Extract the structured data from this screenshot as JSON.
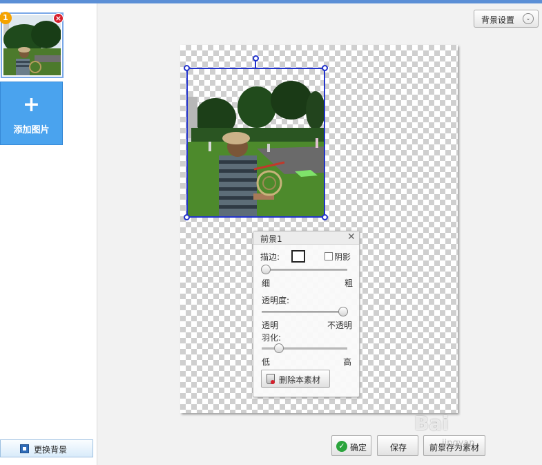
{
  "left_panel": {
    "thumbnail_index": "1",
    "thumbnail_close": "×",
    "add_image_label": "添加图片",
    "add_image_icon": "plus-icon",
    "change_bg_label": "更换背景"
  },
  "toolbar": {
    "bg_settings_label": "背景设置",
    "bg_settings_arrow": "⌄"
  },
  "fg_panel": {
    "title": "前景1",
    "close": "✕",
    "stroke_label": "描边:",
    "shadow_label": "阴影",
    "shadow_checked": false,
    "stroke_min": "细",
    "stroke_max": "粗",
    "stroke_value": 0.05,
    "opacity_label": "透明度:",
    "opacity_min": "透明",
    "opacity_max": "不透明",
    "opacity_value": 0.95,
    "feather_label": "羽化:",
    "feather_min": "低",
    "feather_max": "高",
    "feather_value": 0.2,
    "delete_label": "删除本素材"
  },
  "bottom_buttons": {
    "ok_label": "确定",
    "save_label": "保存",
    "save_fg_label": "前景存为素材"
  },
  "watermark": {
    "text": "Bai",
    "sub": "jingyan"
  },
  "colors": {
    "selection": "#2233cc",
    "accent": "#4aa3ee"
  }
}
